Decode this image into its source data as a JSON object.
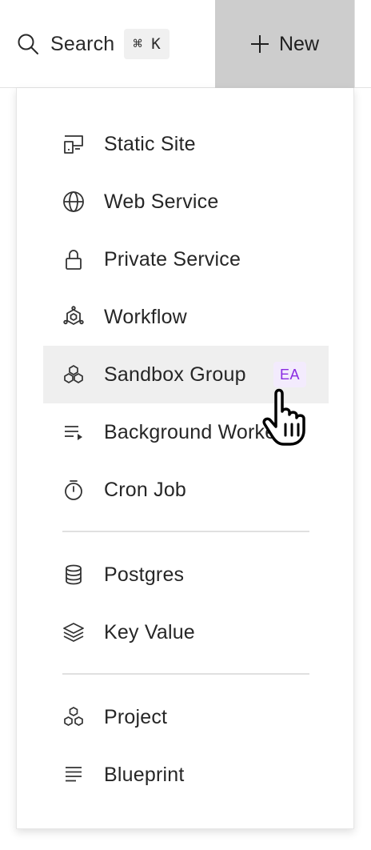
{
  "topbar": {
    "search_label": "Search",
    "search_shortcut": "⌘ K",
    "new_label": "New"
  },
  "menu": {
    "group1": [
      {
        "label": "Static Site",
        "icon": "static-site-icon"
      },
      {
        "label": "Web Service",
        "icon": "globe-icon"
      },
      {
        "label": "Private Service",
        "icon": "lock-icon"
      },
      {
        "label": "Workflow",
        "icon": "workflow-icon"
      },
      {
        "label": "Sandbox Group",
        "icon": "cubes-icon",
        "badge": "EA",
        "hovered": true
      },
      {
        "label": "Background Worker",
        "icon": "list-play-icon"
      },
      {
        "label": "Cron Job",
        "icon": "stopwatch-icon"
      }
    ],
    "group2": [
      {
        "label": "Postgres",
        "icon": "database-icon"
      },
      {
        "label": "Key Value",
        "icon": "layers-icon"
      }
    ],
    "group3": [
      {
        "label": "Project",
        "icon": "project-icon"
      },
      {
        "label": "Blueprint",
        "icon": "blueprint-icon"
      }
    ]
  },
  "colors": {
    "new_button_bg": "#cdcdcd",
    "hover_bg": "#efefef",
    "badge_bg": "#f3ebfd",
    "badge_text": "#8a2be2"
  }
}
